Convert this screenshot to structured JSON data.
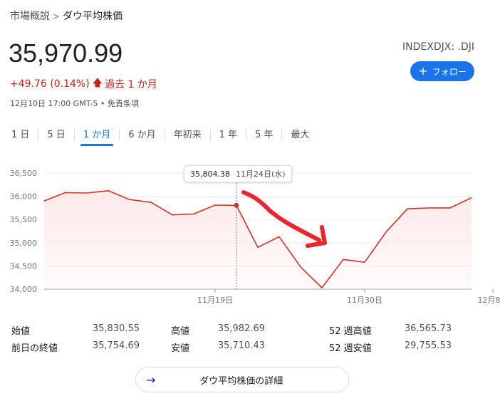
{
  "breadcrumb": {
    "parent": "市場概説",
    "separator": ">",
    "current": "ダウ平均株価"
  },
  "quote": {
    "price": "35,970.99",
    "change": "+49.76 (0.14%)",
    "period": "過去 1 か月",
    "timestamp": "12月10日 17:00 GMT-5 • 免責条項",
    "ticker": "INDEXDJX: .DJI"
  },
  "follow_button": {
    "label": "フォロー"
  },
  "tabs": [
    {
      "label": "1 日",
      "active": false
    },
    {
      "label": "5 日",
      "active": false
    },
    {
      "label": "1 か月",
      "active": true
    },
    {
      "label": "6 か月",
      "active": false
    },
    {
      "label": "年初来",
      "active": false
    },
    {
      "label": "1 年",
      "active": false
    },
    {
      "label": "5 年",
      "active": false
    },
    {
      "label": "最大",
      "active": false
    }
  ],
  "tooltip": {
    "value": "35,804.38",
    "date": "11月24日(水)"
  },
  "chart_data": {
    "type": "area",
    "y_ticks": [
      "36,500",
      "36,000",
      "35,500",
      "35,000",
      "34,500",
      "34,000"
    ],
    "y_tick_values": [
      36500,
      36000,
      35500,
      35000,
      34500,
      34000
    ],
    "ylim": [
      34000,
      36500
    ],
    "x_ticks": [
      {
        "label": "11月19日",
        "index": 8
      },
      {
        "label": "11月30日",
        "index": 15
      },
      {
        "label": "12月8日",
        "index": 21
      }
    ],
    "series": [
      {
        "values": [
          35900,
          36080,
          36070,
          36120,
          35930,
          35870,
          35600,
          35620,
          35810,
          35804,
          34900,
          35130,
          34480,
          34030,
          34640,
          34580,
          35230,
          35730,
          35750,
          35750,
          35970
        ]
      }
    ],
    "x_index_positions": [
      0,
      1,
      2,
      3,
      4,
      5,
      6,
      7,
      8,
      9,
      10,
      11,
      12,
      13,
      14,
      15,
      16,
      17,
      18,
      19,
      20
    ],
    "highlight_index": 9,
    "line_color": "#d93025",
    "fill_color": "#fce8e6",
    "annotation_color": "#e8262c"
  },
  "stats": {
    "rows": [
      [
        {
          "label": "始値",
          "value": "35,830.55"
        },
        {
          "label": "高値",
          "value": "35,982.69"
        },
        {
          "label": "52 週高値",
          "value": "36,565.73"
        }
      ],
      [
        {
          "label": "前日の終値",
          "value": "35,754.69"
        },
        {
          "label": "安値",
          "value": "35,710.43"
        },
        {
          "label": "52 週安値",
          "value": "29,755.53"
        }
      ]
    ]
  },
  "details_button": {
    "label": "ダウ平均株価の詳細"
  },
  "colors": {
    "accent": "#1a73e8",
    "negative_red": "#c5221f"
  }
}
